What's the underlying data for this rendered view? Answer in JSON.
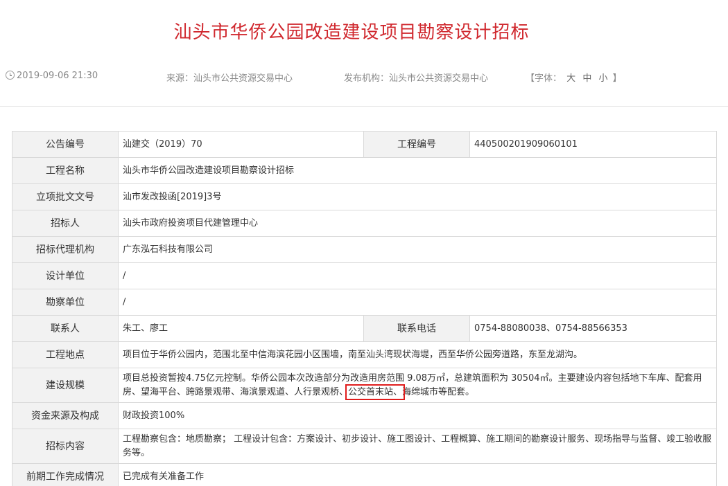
{
  "page": {
    "title": "汕头市华侨公园改造建设项目勘察设计招标",
    "date": "2019-09-06 21:30",
    "source": "来源：汕头市公共资源交易中心",
    "publisher": "发布机构：汕头市公共资源交易中心",
    "font_label_open": "【字体：",
    "font_large": "大",
    "font_medium": "中",
    "font_small": "小",
    "font_label_close": "】"
  },
  "table": {
    "announce_no_label": "公告编号",
    "announce_no": "汕建交（2019）70",
    "project_no_label": "工程编号",
    "project_no": "440500201909060101",
    "project_name_label": "工程名称",
    "project_name": "汕头市华侨公园改造建设项目勘察设计招标",
    "approval_label": "立项批文文号",
    "approval": "汕市发改投函[2019]3号",
    "tenderer_label": "招标人",
    "tenderer": "汕头市政府投资项目代建管理中心",
    "agency_label": "招标代理机构",
    "agency": "广东泓石科技有限公司",
    "design_unit_label": "设计单位",
    "design_unit": "/",
    "survey_unit_label": "勘察单位",
    "survey_unit": "/",
    "contact_label": "联系人",
    "contact": "朱工、廖工",
    "phone_label": "联系电话",
    "phone": "0754-88080038、0754-88566353",
    "location_label": "工程地点",
    "location": "项目位于华侨公园内，范围北至中信海滨花园小区围墙，南至汕头湾现状海堤，西至华侨公园旁道路，东至龙湖沟。",
    "scale_label": "建设规模",
    "scale_part1": "项目总投资暂按4.75亿元控制。华侨公园本次改造部分为改造用房范围 9.08万㎡，总建筑面积为 30504㎡。主要建设内容包括地下车库、配套用房、望海平台、跨路景观带、海滨景观道、人行景观桥、",
    "scale_highlight": "公交首末站、",
    "scale_part2": "海绵城市等配套。",
    "funding_label": "资金来源及构成",
    "funding": "财政投资100%",
    "content_label": "招标内容",
    "content": "工程勘察包含：地质勘察； 工程设计包含：方案设计、初步设计、施工图设计、工程概算、施工期间的勘察设计服务、现场指导与监督、竣工验收服务等。",
    "prework_label": "前期工作完成情况",
    "prework": "已完成有关准备工作"
  }
}
